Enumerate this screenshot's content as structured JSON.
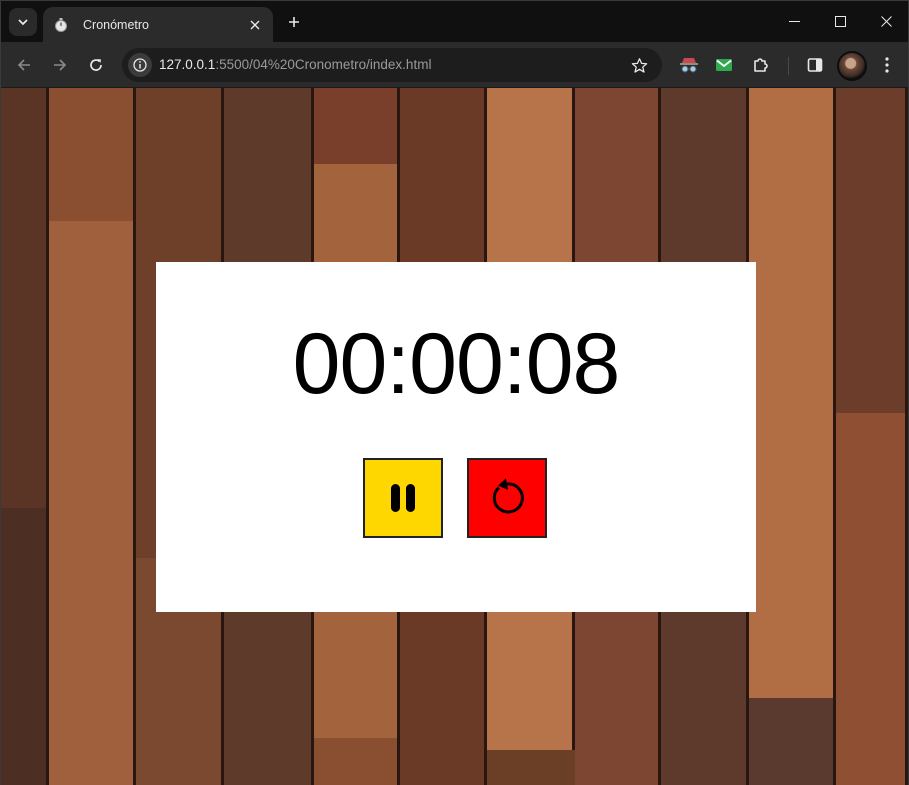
{
  "browser": {
    "tab": {
      "title": "Cronómetro",
      "favicon": "stopwatch-icon"
    },
    "omnibox": {
      "url_host": "127.0.0.1",
      "url_path": ":5500/04%20Cronometro/index.html"
    },
    "icons": [
      "tab-search-icon",
      "close-icon",
      "plus-icon",
      "minimize-icon",
      "maximize-icon",
      "close-icon",
      "back-arrow-icon",
      "forward-arrow-icon",
      "reload-icon",
      "info-icon",
      "star-icon",
      "incognito-extension-icon",
      "mail-extension-icon",
      "puzzle-extensions-icon",
      "side-panel-icon",
      "avatar",
      "kebab-menu-icon"
    ]
  },
  "stopwatch": {
    "time": "00:00:08",
    "pause_button": {
      "icon": "pause-icon",
      "color": "#ffd700"
    },
    "reset_button": {
      "icon": "reset-icon",
      "color": "#ff0000"
    }
  },
  "colors": {
    "panel": "#ffffff",
    "chrome_dark": "#101010",
    "chrome_toolbar": "#2b2b2b"
  }
}
